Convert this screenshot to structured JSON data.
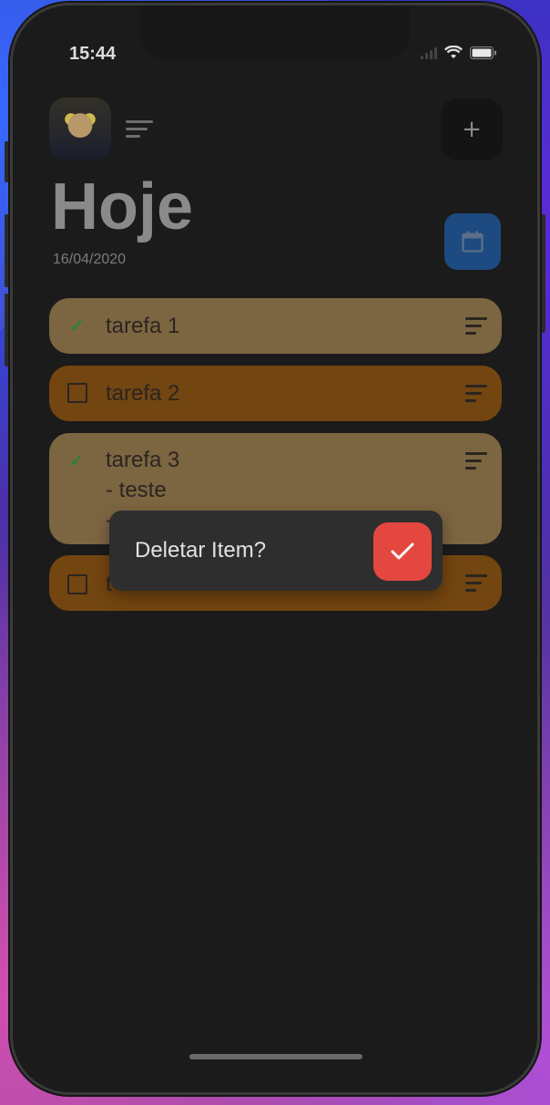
{
  "status_bar": {
    "time": "15:44"
  },
  "header": {
    "title": "Hoje",
    "date": "16/04/2020",
    "add_label": "+"
  },
  "tasks": [
    {
      "label": "tarefa 1",
      "done": true
    },
    {
      "label": "tarefa 2",
      "done": false
    },
    {
      "label": "tarefa 3\n- teste\n-",
      "done": true
    },
    {
      "label": "t",
      "done": false
    }
  ],
  "snackbar": {
    "text": "Deletar Item?"
  },
  "colors": {
    "accent_blue": "#1d4a80",
    "done_card": "#7c6541",
    "todo_card": "#734510",
    "confirm_red": "#e4473f"
  }
}
